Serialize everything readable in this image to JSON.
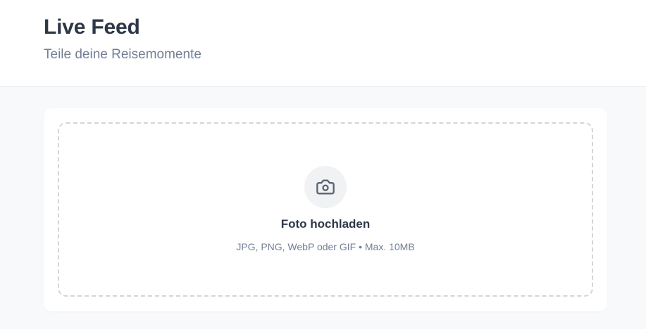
{
  "header": {
    "title": "Live Feed",
    "subtitle": "Teile deine Reisemomente"
  },
  "upload": {
    "icon": "camera-icon",
    "title": "Foto hochladen",
    "hint": "JPG, PNG, WebP oder GIF • Max. 10MB"
  },
  "colors": {
    "title_text": "#2d3748",
    "muted_text": "#718096",
    "page_background": "#f8f9fb",
    "dashed_border": "#d1d5db",
    "icon_background": "#f1f2f4",
    "icon_stroke": "#5b6472"
  }
}
